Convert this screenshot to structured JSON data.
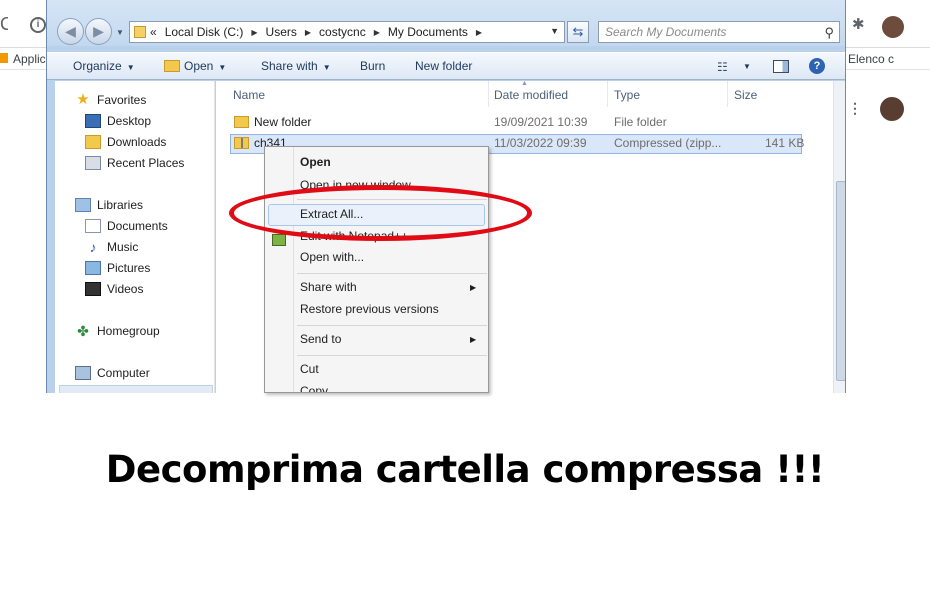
{
  "browser": {
    "apps_label": "Applic",
    "bookmark_right": "Elenco c",
    "reload_glyph": "C",
    "info_glyph": "i",
    "ext_glyph": "✱",
    "dots_glyph": "⋮"
  },
  "explorer": {
    "breadcrumb_prefix": "«",
    "breadcrumbs": [
      "Local Disk (C:)",
      "Users",
      "costycnc",
      "My Documents"
    ],
    "search_placeholder": "Search My Documents",
    "toolbar": {
      "organize": "Organize",
      "open": "Open",
      "share_with": "Share with",
      "burn": "Burn",
      "new_folder": "New folder"
    },
    "nav": {
      "favorites": "Favorites",
      "desktop": "Desktop",
      "downloads": "Downloads",
      "recent_places": "Recent Places",
      "libraries": "Libraries",
      "documents": "Documents",
      "music": "Music",
      "pictures": "Pictures",
      "videos": "Videos",
      "homegroup": "Homegroup",
      "computer": "Computer"
    },
    "columns": {
      "name": "Name",
      "date_modified": "Date modified",
      "type": "Type",
      "size": "Size"
    },
    "files": [
      {
        "name": "New folder",
        "date": "19/09/2021 10:39",
        "type": "File folder",
        "size": ""
      },
      {
        "name": "ch341",
        "date": "11/03/2022 09:39",
        "type": "Compressed (zipp...",
        "size": "141 KB"
      }
    ]
  },
  "context_menu": {
    "open": "Open",
    "open_new_window": "Open in new window",
    "extract_all": "Extract All...",
    "edit_notepad": "Edit with Notepad++",
    "open_with": "Open with...",
    "share_with": "Share with",
    "restore_previous": "Restore previous versions",
    "send_to": "Send to",
    "cut": "Cut",
    "copy": "Copy"
  },
  "annotation": {
    "color": "#e00b14",
    "caption": "Decomprima cartella compressa !!!"
  }
}
